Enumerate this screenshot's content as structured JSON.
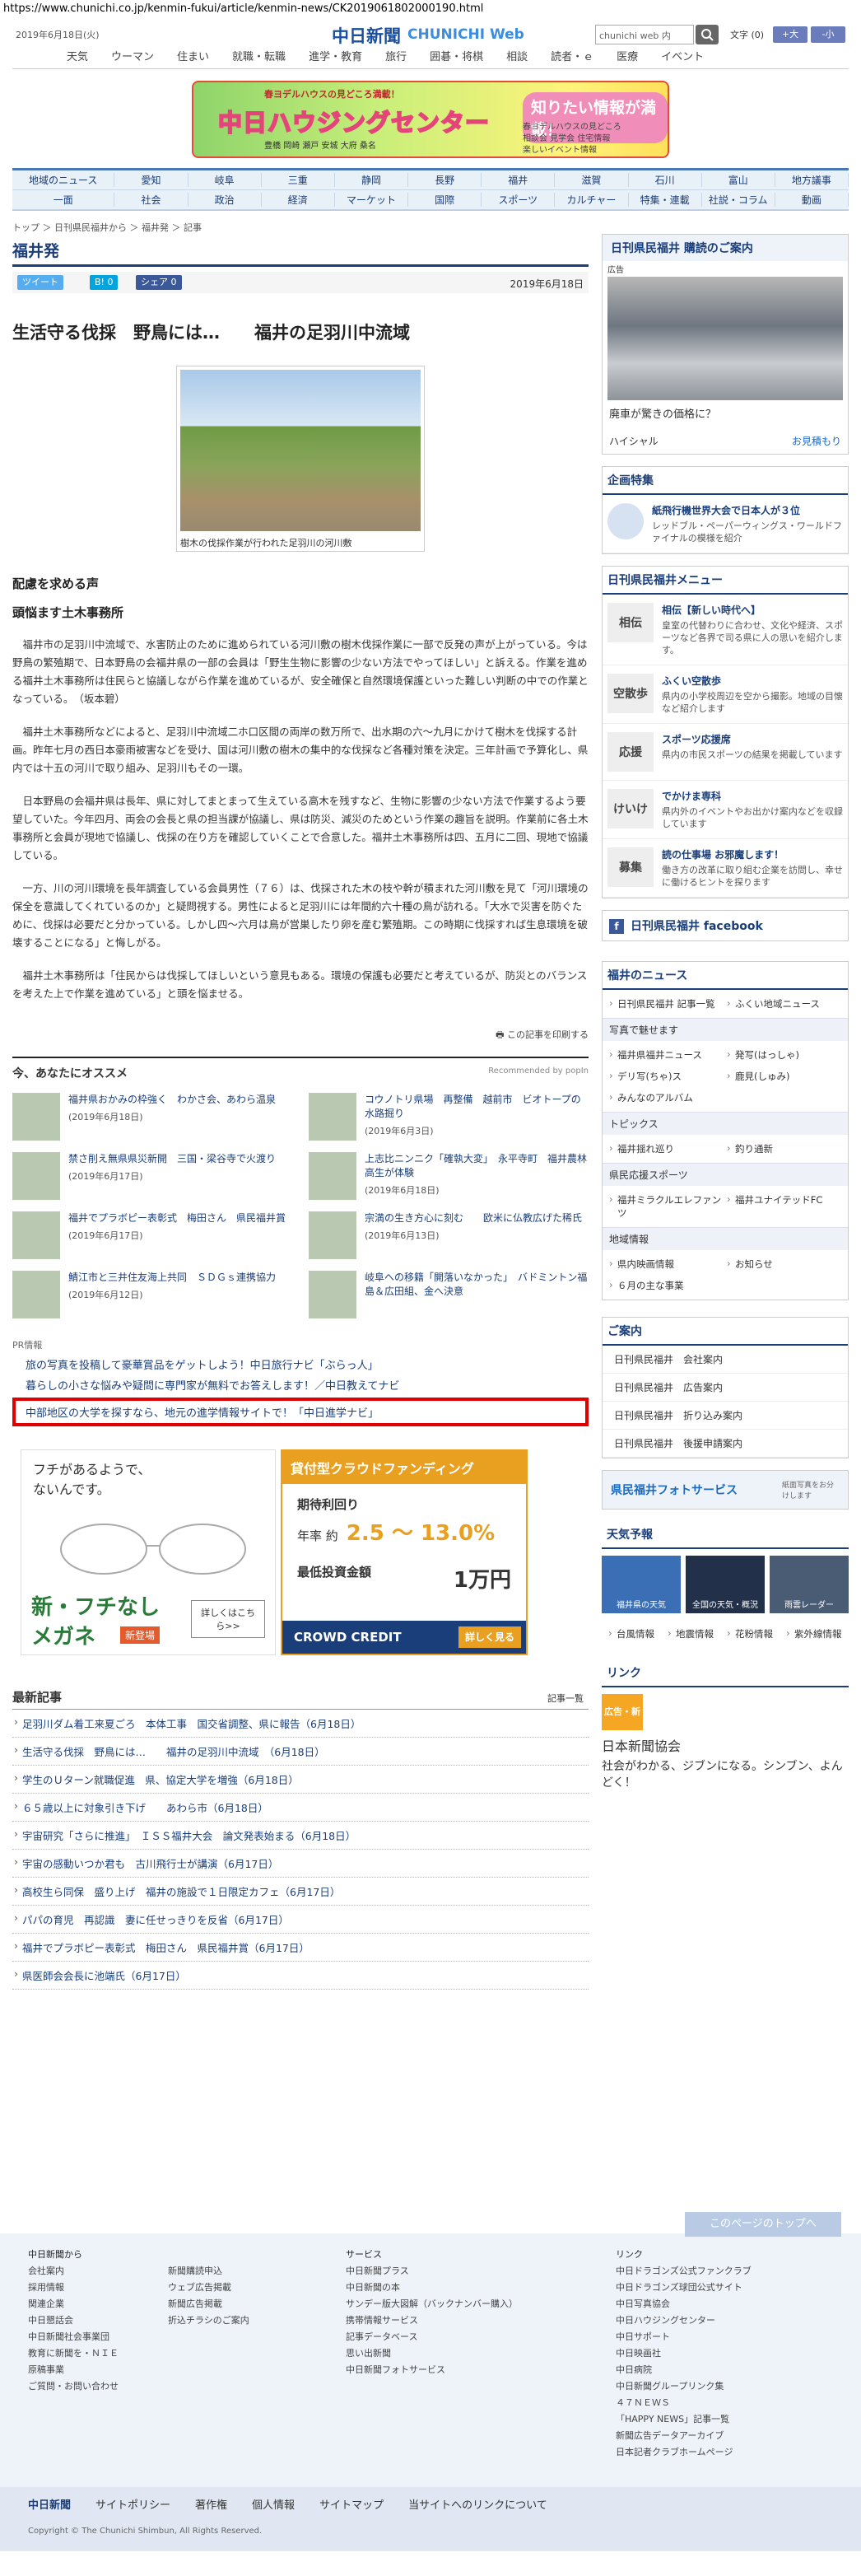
{
  "url": "https://www.chunichi.co.jp/kenmin-fukui/article/kenmin-news/CK2019061802000190.html",
  "header": {
    "date": "2019年6月18日(火)",
    "logo": "中日新聞",
    "logo_web": "CHUNICHI Web",
    "search_placeholder": "chunichi web 内",
    "font_label": "文字",
    "font_value": "(0)",
    "font_big": "+大",
    "font_small": "-小"
  },
  "topnav": [
    "天気",
    "ウーマン",
    "住まい",
    "就職・転職",
    "進学・教育",
    "旅行",
    "囲碁・将棋",
    "相談",
    "読者・ｅ",
    "医療",
    "イベント"
  ],
  "banner": {
    "line1": "春ヨデルハウスの見どころ満載！",
    "title": "中日ハウジングセンター",
    "badge": "知りたい情報が満載！",
    "info": "春ヨデルハウスの見どころ\n相談会 見学会 住宅情報\n楽しいイベント情報",
    "areas": "豊橋 岡崎 瀬戸 安城 大府 桑名"
  },
  "bignav": {
    "row1": [
      "地域のニュース",
      "愛知",
      "岐阜",
      "三重",
      "静岡",
      "長野",
      "福井",
      "滋賀",
      "石川",
      "富山",
      "地方議事"
    ],
    "row2": [
      "一面",
      "社会",
      "政治",
      "経済",
      "マーケット",
      "国際",
      "スポーツ",
      "カルチャー",
      "特集・連載",
      "社説・コラム",
      "動画"
    ]
  },
  "breadcrumb": "トップ ＞ 日刊県民福井から ＞ 福井発 ＞ 記事",
  "section_title": "福井発",
  "share": {
    "tweet": "ツイート",
    "hatena": "B! 0",
    "fb": "シェア 0",
    "date": "2019年6月18日"
  },
  "article": {
    "title": "生活守る伐採　野鳥には…　　福井の足羽川中流域",
    "caption": "樹木の伐採作業が行われた足羽川の河川敷",
    "sub1": "配慮を求める声",
    "sub2": "頭悩ます土木事務所",
    "paras": [
      "福井市の足羽川中流域で、水害防止のために進められている河川敷の樹木伐採作業に一部で反発の声が上がっている。今は野鳥の繁殖期で、日本野鳥の会福井県の一部の会員は「野生生物に影響の少ない方法でやってほしい」と訴える。作業を進める福井土木事務所は住民らと協議しながら作業を進めているが、安全確保と自然環境保護といった難しい判断の中での作業となっている。　（坂本碧）",
      "福井土木事務所などによると、足羽川中流域二ホ口区間の両岸の数万所で、出水期の六〜九月にかけて樹木を伐採する計画。昨年七月の西日本豪雨被害などを受け、国は河川敷の樹木の集中的な伐採など各種対策を決定。三年計画で予算化し、県内では十五の河川で取り組み、足羽川もその一環。",
      "日本野鳥の会福井県は長年、県に対してまとまって生えている高木を残すなど、生物に影響の少ない方法で作業するよう要望していた。今年四月、両会の会長と県の担当課が協議し、県は防災、減災のためという作業の趣旨を説明。作業前に各土木事務所と会員が現地で協議し、伐採の在り方を確認していくことで合意した。福井土木事務所は四、五月に二回、現地で協議している。",
      "一方、川の河川環境を長年調査している会員男性（７６）は、伐採された木の枝や幹が積まれた河川敷を見て「河川環境の保全を意識してくれているのか」と疑問視する。男性によると足羽川には年間約六十種の鳥が訪れる。「大水で災害を防ぐために、伐採は必要だと分かっている。しかし四〜六月は鳥が営巣したり卵を産む繁殖期。この時期に伐採すれば生息環境を破壊することになる」と悔しがる。",
      "福井土木事務所は「住民からは伐採してほしいという意見もある。環境の保護も必要だと考えているが、防災とのバランスを考えた上で作業を進めている」と頭を悩ませる。"
    ],
    "print": "この記事を印刷する"
  },
  "recommend": {
    "title": "今、あなたにオススメ",
    "by": "Recommended by popIn",
    "items": [
      {
        "t": "福井県おかみの枠強く　わかさ会、あわら温泉",
        "d": "(2019年6月18日)"
      },
      {
        "t": "コウノトリ県場　再整備　越前市　ビオトープの水路掘り",
        "d": "(2019年6月3日)"
      },
      {
        "t": "禁さ削え無県県災新開　三国・梁谷寺で火渡り",
        "d": "(2019年6月17日)"
      },
      {
        "t": "上志比ニンニク「確執大変」　永平寺町　福井農林高生が体験",
        "d": "(2019年6月18日)"
      },
      {
        "t": "福井でプラボピー表彰式　梅田さん　県民福井賞",
        "d": "(2019年6月17日)"
      },
      {
        "t": "宗満の生き方心に刻む　　欧米に仏教広げた稀氏",
        "d": "(2019年6月13日)"
      },
      {
        "t": "鯖江市と三井住友海上共同　ＳＤＧｓ連携協力",
        "d": "(2019年6月12日)"
      },
      {
        "t": "岐阜への移籍「開落いなかった」　バドミントン福島＆広田組、金へ決意",
        "d": ""
      }
    ]
  },
  "pr": {
    "label": "PR情報",
    "items": [
      "旅の写真を投稿して豪華賞品をゲットしよう！中日旅行ナビ「ぶらっ人」",
      "暮らしの小さな悩みや疑問に専門家が無料でお答えします！／中日教えてナビ",
      "中部地区の大学を探すなら、地元の進学情報サイトで！「中日進学ナビ」"
    ]
  },
  "ad1": {
    "line1": "フチがあるようで、",
    "line2": "ないんです。",
    "big1": "新・フチなし",
    "big2": "メガネ",
    "new": "新登場",
    "more": "詳しくはこちら>>"
  },
  "ad2": {
    "head": "貸付型クラウドファンディング",
    "label1": "期待利回り",
    "label2": "年率 約",
    "rate": "2.5 ～ 13.0%",
    "min": "最低投資金額",
    "amt": "1万円",
    "brand": "CROWD CREDIT",
    "btn": "詳しく見る"
  },
  "latest": {
    "title": "最新記事",
    "more": "記事一覧",
    "items": [
      "足羽川ダム着工来夏ごろ　本体工事　国交省調整、県に報告（6月18日）",
      "生活守る伐採　野鳥には…　　福井の足羽川中流域　（6月18日）",
      "学生のＵターン就職促進　県、協定大学を増強（6月18日）",
      "６５歳以上に対象引き下げ　　あわら市（6月18日）",
      "宇宙研究「さらに推進」　ＩＳＳ福井大会　論文発表始まる（6月18日）",
      "宇宙の感動いつか君も　古川飛行士が講演（6月17日）",
      "高校生ら同保　盛り上げ　福井の施設で１日限定カフェ（6月17日）",
      "パパの育児　再認識　妻に任せっきりを反省（6月17日）",
      "福井でプラボピー表彰式　梅田さん　県民福井賞（6月17日）",
      "県医師会会長に池端氏（6月17日）"
    ]
  },
  "side": {
    "adtitle": "日刊県民福井 購読のご案内",
    "ad_label": "広告",
    "ad_caption": "廃車が驚きの価格に？",
    "ad_brand": "ハイシャル",
    "ad_more": "お見積もり",
    "special": {
      "title": "企画特集",
      "t": "紙飛行機世界大会で日本人が３位",
      "d": "レッドブル・ペーパーウィングス・ワールドファイナルの模様を紹介"
    },
    "menu": {
      "title": "日刊県民福井メニュー",
      "items": [
        {
          "ic": "相伝",
          "t": "相伝【新しい時代へ】",
          "d": "皇室の代替わりに合わせ、文化や経済、スポーツなど各界で司る県に人の思いを紹介します。"
        },
        {
          "ic": "空散歩",
          "t": "ふくい空散歩",
          "d": "県内の小学校周辺を空から撮影。地域の目懐など紹介します"
        },
        {
          "ic": "応援",
          "t": "スポーツ応援席",
          "d": "県内の市民スポーツの結果を掲載しています"
        },
        {
          "ic": "けいけ",
          "t": "でかけま専科",
          "d": "県内外のイベントやお出かけ案内などを収録しています"
        },
        {
          "ic": "募集",
          "t": "読の仕事場 お邪魔します！",
          "d": "働き方の改革に取り組む企業を訪問し、幸せに働けるヒントを探ります"
        }
      ]
    },
    "facebook": "日刊県民福井 facebook",
    "news": {
      "title": "福井のニュース",
      "pairs": [
        "日刊県民福井 記事一覧",
        "ふくい地域ニュース"
      ],
      "sub1": "写真で魅せます",
      "l1": [
        "福井県福井ニュース",
        "発写(はっしゃ)",
        "デリ写(ちゃ)ス",
        "鹿見(しゅみ)",
        "みんなのアルバム"
      ],
      "sub2": "トピックス",
      "l2": [
        "福井揺れ巡り",
        "釣り通新"
      ],
      "sub3": "県民応援スポーツ",
      "l3": [
        "福井ミラクルエレファンツ",
        "福井ユナイテッドFC"
      ],
      "sub4": "地域情報",
      "l4": [
        "県内映画情報",
        "お知らせ",
        "６月の主な事業"
      ]
    },
    "guide": {
      "title": "ご案内",
      "items": [
        "日刊県民福井　会社案内",
        "日刊県民福井　広告案内",
        "日刊県民福井　折り込み案内",
        "日刊県民福井　後援申請案内"
      ]
    },
    "photo": "県民福井フォトサービス",
    "photo_sub": "紙面写真をお分けします",
    "weather": {
      "title": "天気予報",
      "tiles": [
        "福井県の天気",
        "全国の天気・概況",
        "雨雲レーダー"
      ],
      "links": [
        "台風情報",
        "地震情報",
        "花粉情報",
        "紫外線情報"
      ]
    },
    "link": {
      "title": "リンク",
      "logo": "広告・新",
      "org": "日本新聞協会",
      "msg": "社会がわかる、ジブンになる。シンブン、よんどく！"
    }
  },
  "pagetop": "このページのトップへ",
  "footer": {
    "c1_title": "中日新聞から",
    "c1": [
      "会社案内",
      "採用情報",
      "関連企業",
      "中日懇話会",
      "中日新聞社会事業団",
      "教育に新聞を・ＮＩＥ",
      "原稿事業",
      "ご質問・お問い合わせ"
    ],
    "c2": [
      "新聞購読申込",
      "ウェブ広告掲載",
      "新聞広告掲載",
      "折込チラシのご案内"
    ],
    "c3_title": "サービス",
    "c3": [
      "中日新聞プラス",
      "中日新聞の本",
      "サンデー版大図解（バックナンバー購入）",
      "携帯情報サービス",
      "記事データベース",
      "思い出新聞",
      "中日新聞フォトサービス"
    ],
    "c4_title": "リンク",
    "c4": [
      "中日ドラゴンズ公式ファンクラブ",
      "中日ドラゴンズ球団公式サイト",
      "中日写真協会",
      "中日ハウジングセンター",
      "中日サポート",
      "中日映画社",
      "中日病院",
      "中日新聞グループリンク集",
      "４７ＮＥＷＳ",
      "「HAPPY NEWS」記事一覧",
      "新聞広告データアーカイブ",
      "日本記者クラブホームページ"
    ],
    "bar": [
      "中日新聞",
      "サイトポリシー",
      "著作権",
      "個人情報",
      "サイトマップ",
      "当サイトへのリンクについて"
    ],
    "copy": "Copyright © The Chunichi Shimbun, All Rights Reserved."
  }
}
